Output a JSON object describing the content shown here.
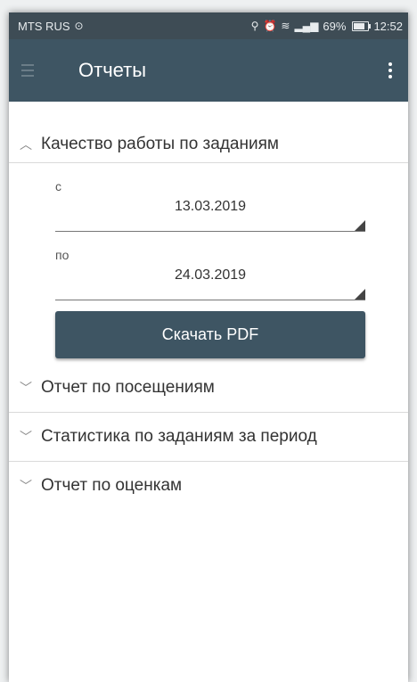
{
  "status_bar": {
    "carrier": "MTS RUS",
    "signal_percent": "69%",
    "time": "12:52"
  },
  "app_bar": {
    "title": "Отчеты"
  },
  "reports": {
    "expanded": {
      "title": "Качество работы по заданиям",
      "from_label": "с",
      "from_value": "13.03.2019",
      "to_label": "по",
      "to_value": "24.03.2019",
      "download_label": "Скачать PDF"
    },
    "collapsed": [
      {
        "title": "Отчет по посещениям"
      },
      {
        "title": "Статистика по заданиям за период"
      },
      {
        "title": "Отчет по оценкам"
      }
    ]
  },
  "icons": {
    "menu": "menu-icon",
    "more": "more-vert-icon",
    "chevron_up": "chevron-up-icon",
    "chevron_down": "chevron-down-icon"
  },
  "colors": {
    "status_bar": "#3e4c55",
    "app_bar": "#3e5563",
    "button": "#3e5563"
  }
}
